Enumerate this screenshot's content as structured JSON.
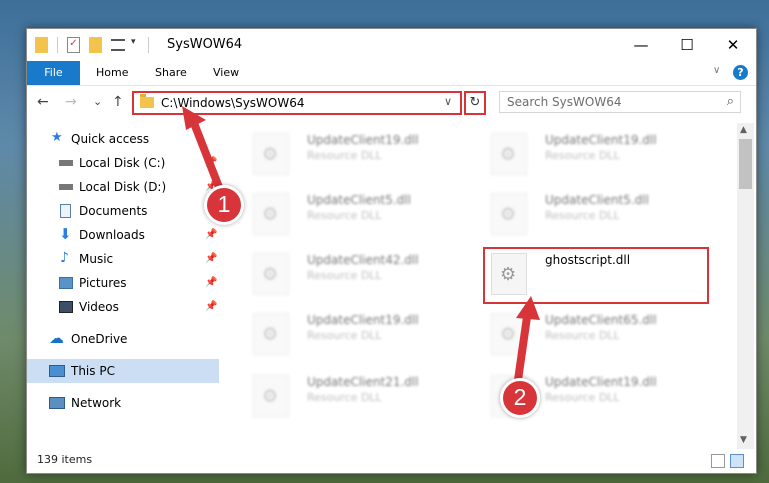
{
  "window": {
    "title": "SysWOW64",
    "minimize": "—",
    "maximize": "☐",
    "close": "✕"
  },
  "ribbon": {
    "file": "File",
    "home": "Home",
    "share": "Share",
    "view": "View",
    "help": "?",
    "collapse": "∨"
  },
  "nav": {
    "back": "←",
    "forward": "→",
    "recent": "⌄",
    "up": "↑",
    "address": "C:\\Windows\\SysWOW64",
    "address_dd": "∨",
    "refresh": "↻",
    "search_placeholder": "Search SysWOW64",
    "search_icon": "⌕"
  },
  "sidebar": {
    "items": [
      {
        "label": "Quick access",
        "icon": "star-icon",
        "pinned": false
      },
      {
        "label": "Local Disk (C:)",
        "icon": "drive-icon",
        "pinned": true
      },
      {
        "label": "Local Disk (D:)",
        "icon": "drive-icon",
        "pinned": true
      },
      {
        "label": "Documents",
        "icon": "documents-icon",
        "pinned": true
      },
      {
        "label": "Downloads",
        "icon": "downloads-icon",
        "pinned": true
      },
      {
        "label": "Music",
        "icon": "music-icon",
        "pinned": true
      },
      {
        "label": "Pictures",
        "icon": "pictures-icon",
        "pinned": true
      },
      {
        "label": "Videos",
        "icon": "videos-icon",
        "pinned": true
      },
      {
        "label": "OneDrive",
        "icon": "cloud-icon",
        "pinned": false
      },
      {
        "label": "This PC",
        "icon": "pc-icon",
        "pinned": false,
        "selected": true
      },
      {
        "label": "Network",
        "icon": "network-icon",
        "pinned": false
      }
    ],
    "pin_glyph": "📌"
  },
  "files": [
    {
      "name": "UpdateClient19.dll",
      "desc": "Resource DLL"
    },
    {
      "name": "UpdateClient19.dll",
      "desc": "Resource DLL"
    },
    {
      "name": "UpdateClient5.dll",
      "desc": "Resource DLL"
    },
    {
      "name": "UpdateClient5.dll",
      "desc": "Resource DLL"
    },
    {
      "name": "UpdateClient42.dll",
      "desc": "Resource DLL"
    },
    {
      "name": "ghostscript.dll",
      "desc": ""
    },
    {
      "name": "UpdateClient19.dll",
      "desc": "Resource DLL"
    },
    {
      "name": "UpdateClient65.dll",
      "desc": "Resource DLL"
    },
    {
      "name": "UpdateClient21.dll",
      "desc": "Resource DLL"
    },
    {
      "name": "UpdateClient19.dll",
      "desc": "Resource DLL"
    }
  ],
  "status": {
    "count": "139 items"
  },
  "annotations": {
    "step1": "1",
    "step2": "2"
  },
  "colors": {
    "accent": "#1979ca",
    "highlight": "#d9333a",
    "selected": "#ccdef3"
  }
}
